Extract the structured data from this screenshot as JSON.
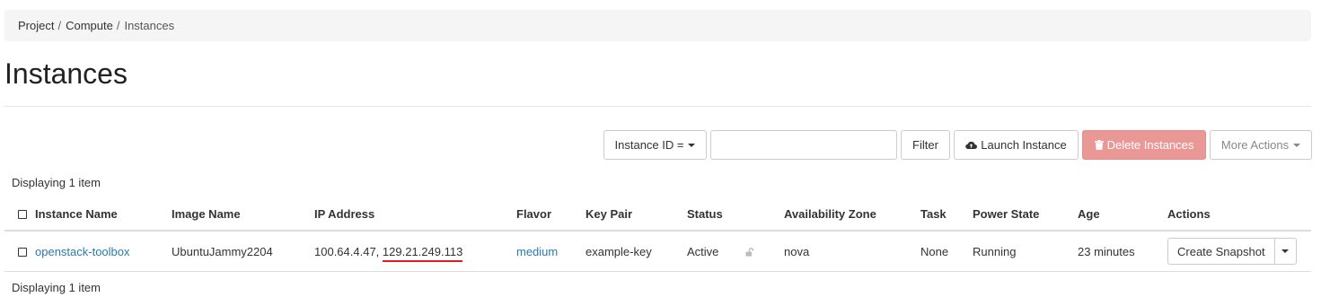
{
  "breadcrumb": {
    "items": [
      "Project",
      "Compute",
      "Instances"
    ],
    "separator": "/"
  },
  "page": {
    "title": "Instances"
  },
  "toolbar": {
    "filter_field": "Instance ID =",
    "filter_value": "",
    "filter_label": "Filter",
    "launch_label": "Launch Instance",
    "delete_label": "Delete Instances",
    "more_label": "More Actions",
    "colors": {
      "delete_bg": "#ea9896",
      "link": "#2a7ab0",
      "ip_highlight": "#e0201c"
    }
  },
  "summary": {
    "top": "Displaying 1 item",
    "bottom": "Displaying 1 item"
  },
  "table": {
    "columns": [
      "Instance Name",
      "Image Name",
      "IP Address",
      "Flavor",
      "Key Pair",
      "Status",
      "Availability Zone",
      "Task",
      "Power State",
      "Age",
      "Actions"
    ],
    "rows": [
      {
        "name": "openstack-toolbox",
        "image": "UbuntuJammy2204",
        "ip_private": "100.64.4.47, ",
        "ip_public": "129.21.249.113",
        "flavor": "medium",
        "key_pair": "example-key",
        "status": "Active",
        "status_icon": "unlock-icon",
        "availability_zone": "nova",
        "task": "None",
        "power_state": "Running",
        "age": "23 minutes",
        "action": "Create Snapshot"
      }
    ]
  }
}
